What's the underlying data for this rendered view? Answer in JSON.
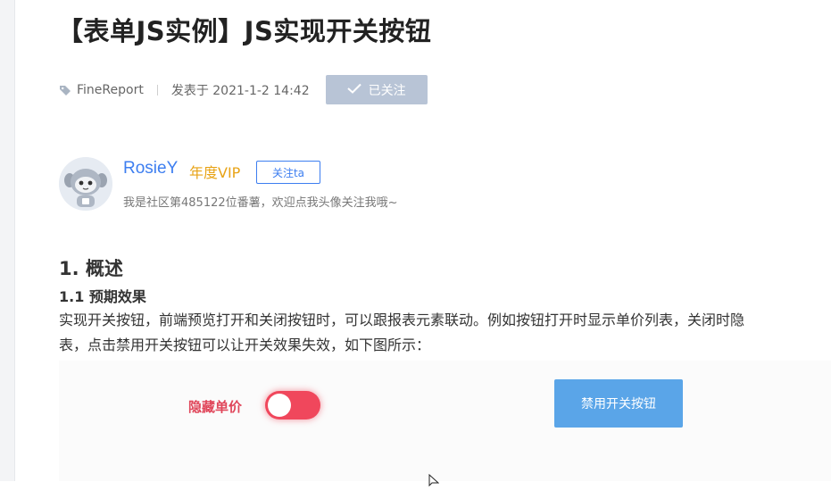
{
  "article": {
    "title": "【表单JS实例】JS实现开关按钮",
    "category": "FineReport",
    "published": "发表于 2021-1-2 14:42",
    "follow_status_label": "已关注"
  },
  "author": {
    "name": "RosieY",
    "vip_label": "年度VIP",
    "follow_label": "关注ta",
    "bio": "我是社区第485122位番薯，欢迎点我头像关注我哦~"
  },
  "content": {
    "heading_1": "1. 概述",
    "heading_2": "1.1 预期效果",
    "paragraph_line_1": "实现开关按钮，前端预览打开和关闭按钮时，可以跟报表元素联动。例如按钮打开时显示单价列表，关闭时隐",
    "paragraph_line_2": "表，点击禁用开关按钮可以让开关效果失效，如下图所示："
  },
  "demo": {
    "toggle_label": "隐藏单价",
    "toggle_on": true,
    "disable_button_label": "禁用开关按钮"
  },
  "colors": {
    "link_blue": "#3d7ef0",
    "vip_gold": "#e8a316",
    "toggle_red": "#f0475c",
    "followed_gray": "#b8c4d6",
    "demo_button_blue": "#5aa5e8"
  },
  "icons": {
    "category": "tag-icon",
    "followed": "check-icon",
    "cursor": "mouse-cursor-icon"
  }
}
